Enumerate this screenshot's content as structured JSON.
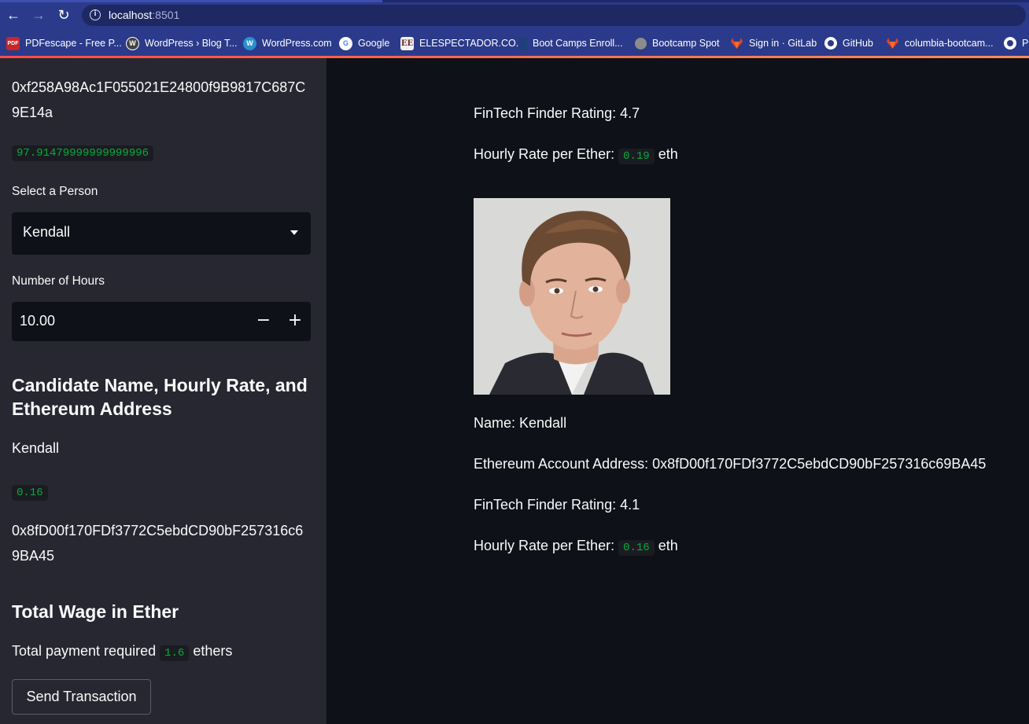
{
  "browser": {
    "url_host": "localhost",
    "url_port": ":8501",
    "bookmarks": [
      {
        "label": "PDFescape - Free P...",
        "icon": "pdf-icon",
        "icon_text": "PDF",
        "color": "#c62828"
      },
      {
        "label": "WordPress › Blog T...",
        "icon": "wordpress-icon",
        "icon_text": "W",
        "color": "#444444"
      },
      {
        "label": "WordPress.com",
        "icon": "wordpress-com-icon",
        "icon_text": "W",
        "color": "#2a8fd0"
      },
      {
        "label": "Google",
        "icon": "google-icon",
        "icon_text": "G",
        "color": "#4a5a9c"
      },
      {
        "label": "ELESPECTADOR.CO...",
        "icon": "elespectador-icon",
        "icon_text": "EE",
        "color": "#6d2a2a"
      },
      {
        "label": "Boot Camps Enroll...",
        "icon": "bootcamp-icon",
        "icon_text": "",
        "color": "#1e3f7a"
      },
      {
        "label": "Bootcamp Spot",
        "icon": "globe-icon",
        "icon_text": "",
        "color": "#8c8c8c"
      },
      {
        "label": "Sign in · GitLab",
        "icon": "gitlab-icon",
        "icon_text": "",
        "color": "#e24329"
      },
      {
        "label": "GitHub",
        "icon": "github-icon",
        "icon_text": "",
        "color": "#ffffff"
      },
      {
        "label": "columbia-bootcam...",
        "icon": "gitlab-icon",
        "icon_text": "",
        "color": "#e24329"
      },
      {
        "label": "P",
        "icon": "github-icon",
        "icon_text": "",
        "color": "#ffffff"
      }
    ]
  },
  "sidebar": {
    "account_address": "0xf258A98Ac1F055021E24800f9B9817C687C9E14a",
    "account_balance": "97.91479999999999996",
    "select_label": "Select a Person",
    "select_value": "Kendall",
    "hours_label": "Number of Hours",
    "hours_value": "10.00",
    "candidate_heading": "Candidate Name, Hourly Rate, and Ethereum Address",
    "candidate_name": "Kendall",
    "candidate_rate": "0.16",
    "candidate_address": "0x8fD00f170FDf3772C5ebdCD90bF257316c69BA45",
    "wage_heading": "Total Wage in Ether",
    "total_prefix": "Total payment required",
    "total_value": "1.6",
    "total_suffix": "ethers",
    "send_label": "Send Transaction"
  },
  "main": {
    "prev_rating": "FinTech Finder Rating: 4.7",
    "prev_rate_prefix": "Hourly Rate per Ether:",
    "prev_rate_value": "0.19",
    "prev_rate_suffix": "eth",
    "name_line": "Name: Kendall",
    "address_line": "Ethereum Account Address: 0x8fD00f170FDf3772C5ebdCD90bF257316c69BA45",
    "rating_line": "FinTech Finder Rating: 4.1",
    "rate_prefix": "Hourly Rate per Ether:",
    "rate_value": "0.16",
    "rate_suffix": "eth"
  },
  "colors": {
    "sidebar_bg": "#262730",
    "main_bg": "#0e1117",
    "code_green": "#09ab3b",
    "browser_bar": "#2b3a8a"
  }
}
